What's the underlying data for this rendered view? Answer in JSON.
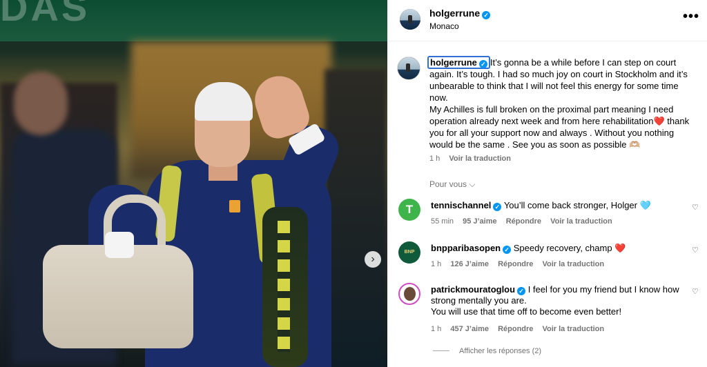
{
  "post": {
    "username": "holgerrune",
    "location": "Monaco",
    "more_label": "•••",
    "next_label": "›",
    "banner_text": "DAS"
  },
  "caption": {
    "username": "holgerrune",
    "text": "It’s gonna be a while before I can step on court again. It’s tough. I had so much joy on court in Stockholm and it’s unbearable to think that I will not feel this energy for some time now.",
    "text2": "My Achilles is full broken on the proximal part meaning I need operation already next week and from here rehabilitation❤️ thank you for all your support now and always . Without you nothing would be the same . See you as soon as possible 🫶🏼",
    "time": "1 h",
    "translate": "Voir la traduction"
  },
  "pour_vous": "Pour vous",
  "comments": [
    {
      "username": "tennischannel",
      "text": "You’ll come back stronger, Holger 🩵",
      "time": "55 min",
      "likes": "95 J’aime",
      "reply": "Répondre",
      "translate": "Voir la traduction",
      "avatar_label": "T",
      "verified": true
    },
    {
      "username": "bnpparibasopen",
      "text": "Speedy recovery, champ ❤️",
      "time": "1 h",
      "likes": "126 J’aime",
      "reply": "Répondre",
      "translate": "Voir la traduction",
      "avatar_label": "BNP",
      "verified": true
    },
    {
      "username": "patrickmouratoglou",
      "text": "I feel for you my friend but I know how strong mentally you are.",
      "text2": "You will use that time off to become even better!",
      "time": "1 h",
      "likes": "457 J’aime",
      "reply": "Répondre",
      "translate": "Voir la traduction",
      "verified": true
    }
  ],
  "replies_label": "Afficher les réponses (2)",
  "colors": {
    "verified": "#0095f6",
    "meta_gray": "#737373",
    "highlight_box": "#2f6fd6"
  }
}
